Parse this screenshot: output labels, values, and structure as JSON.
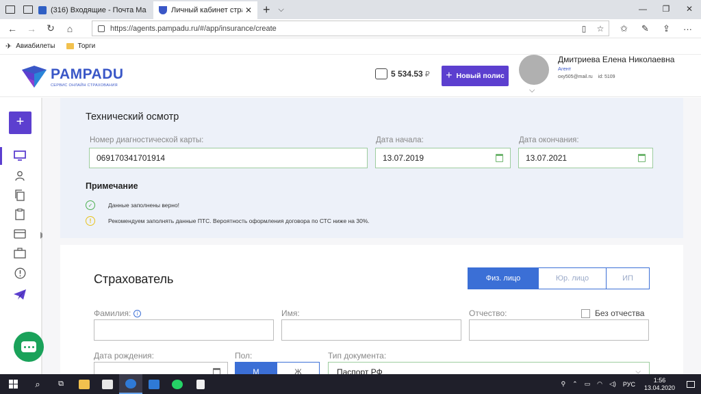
{
  "browser": {
    "tabs": [
      {
        "title": "(316) Входящие - Почта Ма",
        "favicon_color": "#2f5fc4"
      },
      {
        "title": "Личный кабинет страх",
        "favicon_color": "#3a57c7"
      }
    ],
    "url": "https://agents.pampadu.ru/#/app/insurance/create",
    "bookmarks": [
      "Авиабилеты",
      "Торги"
    ]
  },
  "header": {
    "logo_name": "PAMPADU",
    "logo_tagline": "Сервис онлайн страхования",
    "balance": "5 534.53",
    "currency": "₽",
    "new_policy_label": "Новый полис",
    "user": {
      "name": "Дмитриева Елена Николаевна",
      "role": "Агент",
      "email": "oxy505@mail.ru",
      "id_text": "id: 5109"
    }
  },
  "sidebar": {
    "add_label": "+",
    "icons": [
      "monitor-icon",
      "user-icon",
      "copy-icon",
      "clipboard-icon",
      "card-icon",
      "briefcase-icon",
      "alert-icon",
      "send-icon"
    ]
  },
  "tech_inspection": {
    "title": "Технический осмотр",
    "card_label": "Номер диагностической карты:",
    "card_value": "069170341701914",
    "start_label": "Дата начала:",
    "start_value": "13.07.2019",
    "end_label": "Дата окончания:",
    "end_value": "13.07.2021",
    "note_title": "Примечание",
    "note_ok": "Данные заполнены верно!",
    "note_warn": "Рекомендуем заполнять данные ПТС. Вероятность оформления договора по СТС ниже на 30%."
  },
  "insured": {
    "title": "Страхователь",
    "types": [
      "Физ. лицо",
      "Юр. лицо",
      "ИП"
    ],
    "surname_label": "Фамилия:",
    "name_label": "Имя:",
    "patronymic_label": "Отчество:",
    "no_patronymic_label": "Без отчества",
    "birth_label": "Дата рождения:",
    "gender_label": "Пол:",
    "gender_options": [
      "М",
      "Ж"
    ],
    "doc_type_label": "Тип документа:",
    "doc_type_value": "Паспорт РФ"
  },
  "taskbar": {
    "lang": "РУС",
    "time": "1:56",
    "date": "13.04.2020"
  },
  "colors": {
    "brand": "#3a57c7",
    "accent": "#5c3fcf",
    "primary": "#3b6fd6",
    "ok": "#4caf50",
    "warn": "#e8c21b",
    "chat": "#1aa25a"
  }
}
